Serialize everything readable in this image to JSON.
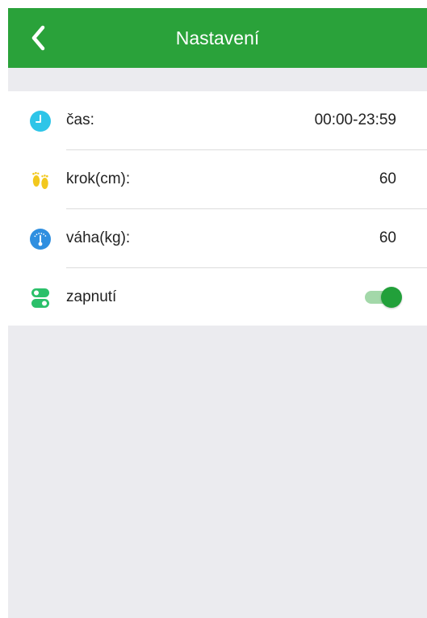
{
  "header": {
    "title": "Nastavení",
    "back_icon": "chevron-left-icon"
  },
  "settings": {
    "items": [
      {
        "label": "čas:",
        "value": "00:00-23:59",
        "icon": "clock-icon"
      },
      {
        "label": "krok(cm):",
        "value": "60",
        "icon": "footprints-icon"
      },
      {
        "label": "váha(kg):",
        "value": "60",
        "icon": "scale-gauge-icon"
      },
      {
        "label": "zapnutí",
        "icon": "toggle-switch-icon",
        "toggle_on": true
      }
    ]
  },
  "colors": {
    "accent": "#2aa23a",
    "background": "#ebebef",
    "clock_icon": "#2ec5e8",
    "footprints_icon": "#f2c81e",
    "scale_icon": "#2f8fe0",
    "toggle_icon": "#2bc06a"
  }
}
